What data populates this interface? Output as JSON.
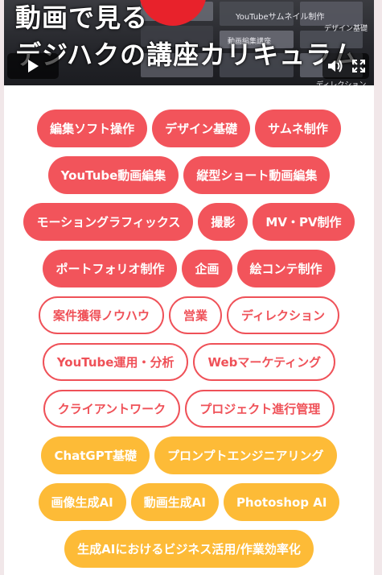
{
  "video": {
    "title_line1": "動画で見る",
    "title_line2": "デジハクの講座カリキュラム",
    "thumb_texts": [
      "YouTubeサムネイル制作",
      "動画編集講座",
      "デザイン基礎",
      "ディレクション"
    ],
    "controls": {
      "play": "play-icon",
      "volume": "volume-icon",
      "fullscreen": "fullscreen-icon"
    }
  },
  "tag_groups": [
    {
      "style": "red",
      "rows": [
        [
          "編集ソフト操作",
          "デザイン基礎",
          "サムネ制作"
        ],
        [
          "YouTube動画編集",
          "縦型ショート動画編集"
        ],
        [
          "モーショングラフィックス",
          "撮影",
          "MV・PV制作"
        ],
        [
          "ポートフォリオ制作",
          "企画",
          "絵コンテ制作"
        ]
      ]
    },
    {
      "style": "outline",
      "rows": [
        [
          "案件獲得ノウハウ",
          "営業",
          "ディレクション"
        ],
        [
          "YouTube運用・分析",
          "Webマーケティング"
        ],
        [
          "クライアントワーク",
          "プロジェクト進行管理"
        ]
      ]
    },
    {
      "style": "yellow",
      "rows": [
        [
          "ChatGPT基礎",
          "プロンプトエンジニアリング"
        ],
        [
          "画像生成AI",
          "動画生成AI",
          "Photoshop AI"
        ],
        [
          "生成AIにおけるビジネス活用/作業効率化"
        ]
      ]
    }
  ],
  "colors": {
    "red": "#f2545b",
    "outline": "#ef5158",
    "yellow": "#fdbb37",
    "background": "#f1e7e9"
  }
}
